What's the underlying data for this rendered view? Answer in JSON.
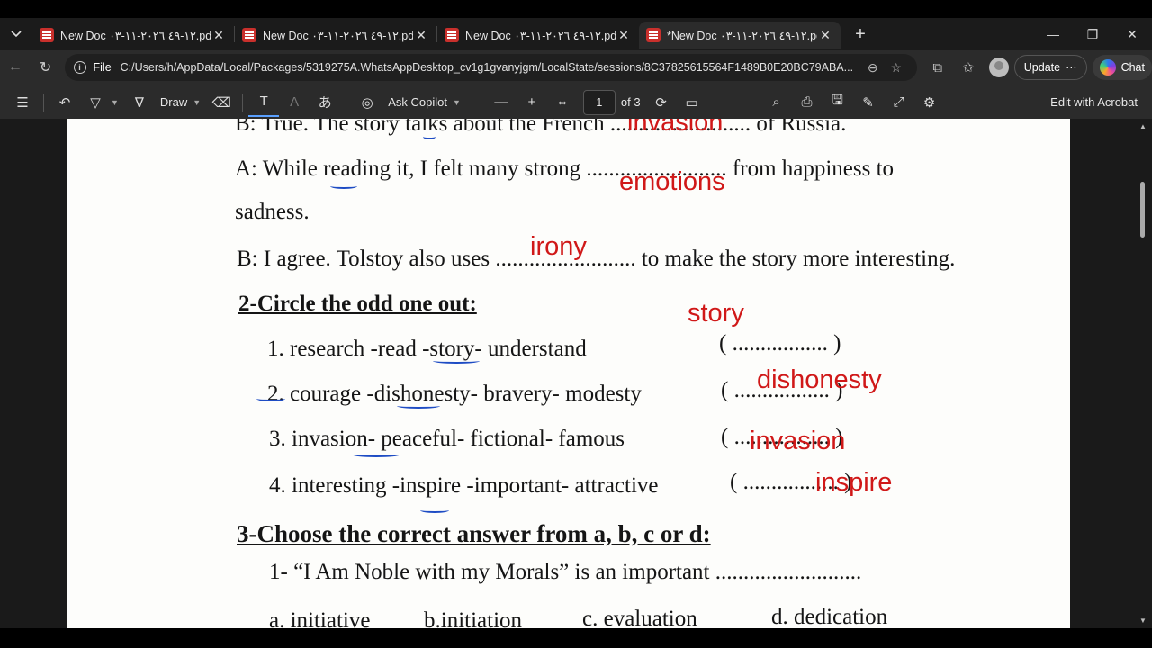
{
  "tabs": [
    {
      "title": "New Doc ١٢-٤٩ ٢٠٢٦-١١-٠٣.pdf",
      "active": false
    },
    {
      "title": "New Doc ١٢-٤٩ ٢٠٢٦-١١-٠٣.pdf",
      "active": false
    },
    {
      "title": "New Doc ١٢-٤٩ ٢٠٢٦-١١-٠٣.pdf",
      "active": false
    },
    {
      "title": "*New Doc ١٢-٤٩ ٢٠٢٦-١١-٠٣.pdf",
      "active": true
    }
  ],
  "address": {
    "scheme_label": "File",
    "url": "C:/Users/h/AppData/Local/Packages/5319275A.WhatsAppDesktop_cv1g1gvanyjgm/LocalState/sessions/8C37825615564F1489B0E20BC79ABA..."
  },
  "browser": {
    "update_label": "Update",
    "update_more": "···",
    "chat_label": "Chat"
  },
  "pdf_toolbar": {
    "draw_label": "Draw",
    "ask_copilot_label": "Ask Copilot",
    "page_current": "1",
    "page_total": "of 3",
    "edit_acrobat_label": "Edit with Acrobat"
  },
  "document": {
    "lines": {
      "l0": "B: True. The story talks about the French ......................... of Russia.",
      "l1": "A: While reading it, I felt many strong ......................... from happiness to",
      "l2": "sadness.",
      "l3": "B: I agree. Tolstoy also uses ......................... to make the story more interesting.",
      "h2": "2-Circle the odd one out:",
      "i1": "1. research -read -story- understand",
      "i1b": "( ................. )",
      "i2": "2. courage -dishonesty- bravery- modesty",
      "i2b": "( ................. )",
      "i3": "3. invasion- peaceful- fictional- famous",
      "i3b": "( ................. )",
      "i4": "4. interesting -inspire -important- attractive",
      "i4b": "( ................. )",
      "h3": "3-Choose the correct answer from a, b, c or d:",
      "q1": "1- “I Am Noble with my Morals” is an important ..........................",
      "oa": "a. initiative",
      "ob": "b.initiation",
      "oc": "c. evaluation",
      "od": "d. dedication"
    },
    "handwriting": {
      "w_invasion": "invasion",
      "w_emotions": "emotions",
      "w_irony": "irony",
      "w_story": "story",
      "w_dishonesty": "dishonesty",
      "w_invasion2": "invasion",
      "w_inspire": "inspire"
    }
  },
  "colors": {
    "handwriting": "#d01818",
    "pen_ink": "#1e4cc4",
    "chrome_bg": "#2b2b2b"
  }
}
